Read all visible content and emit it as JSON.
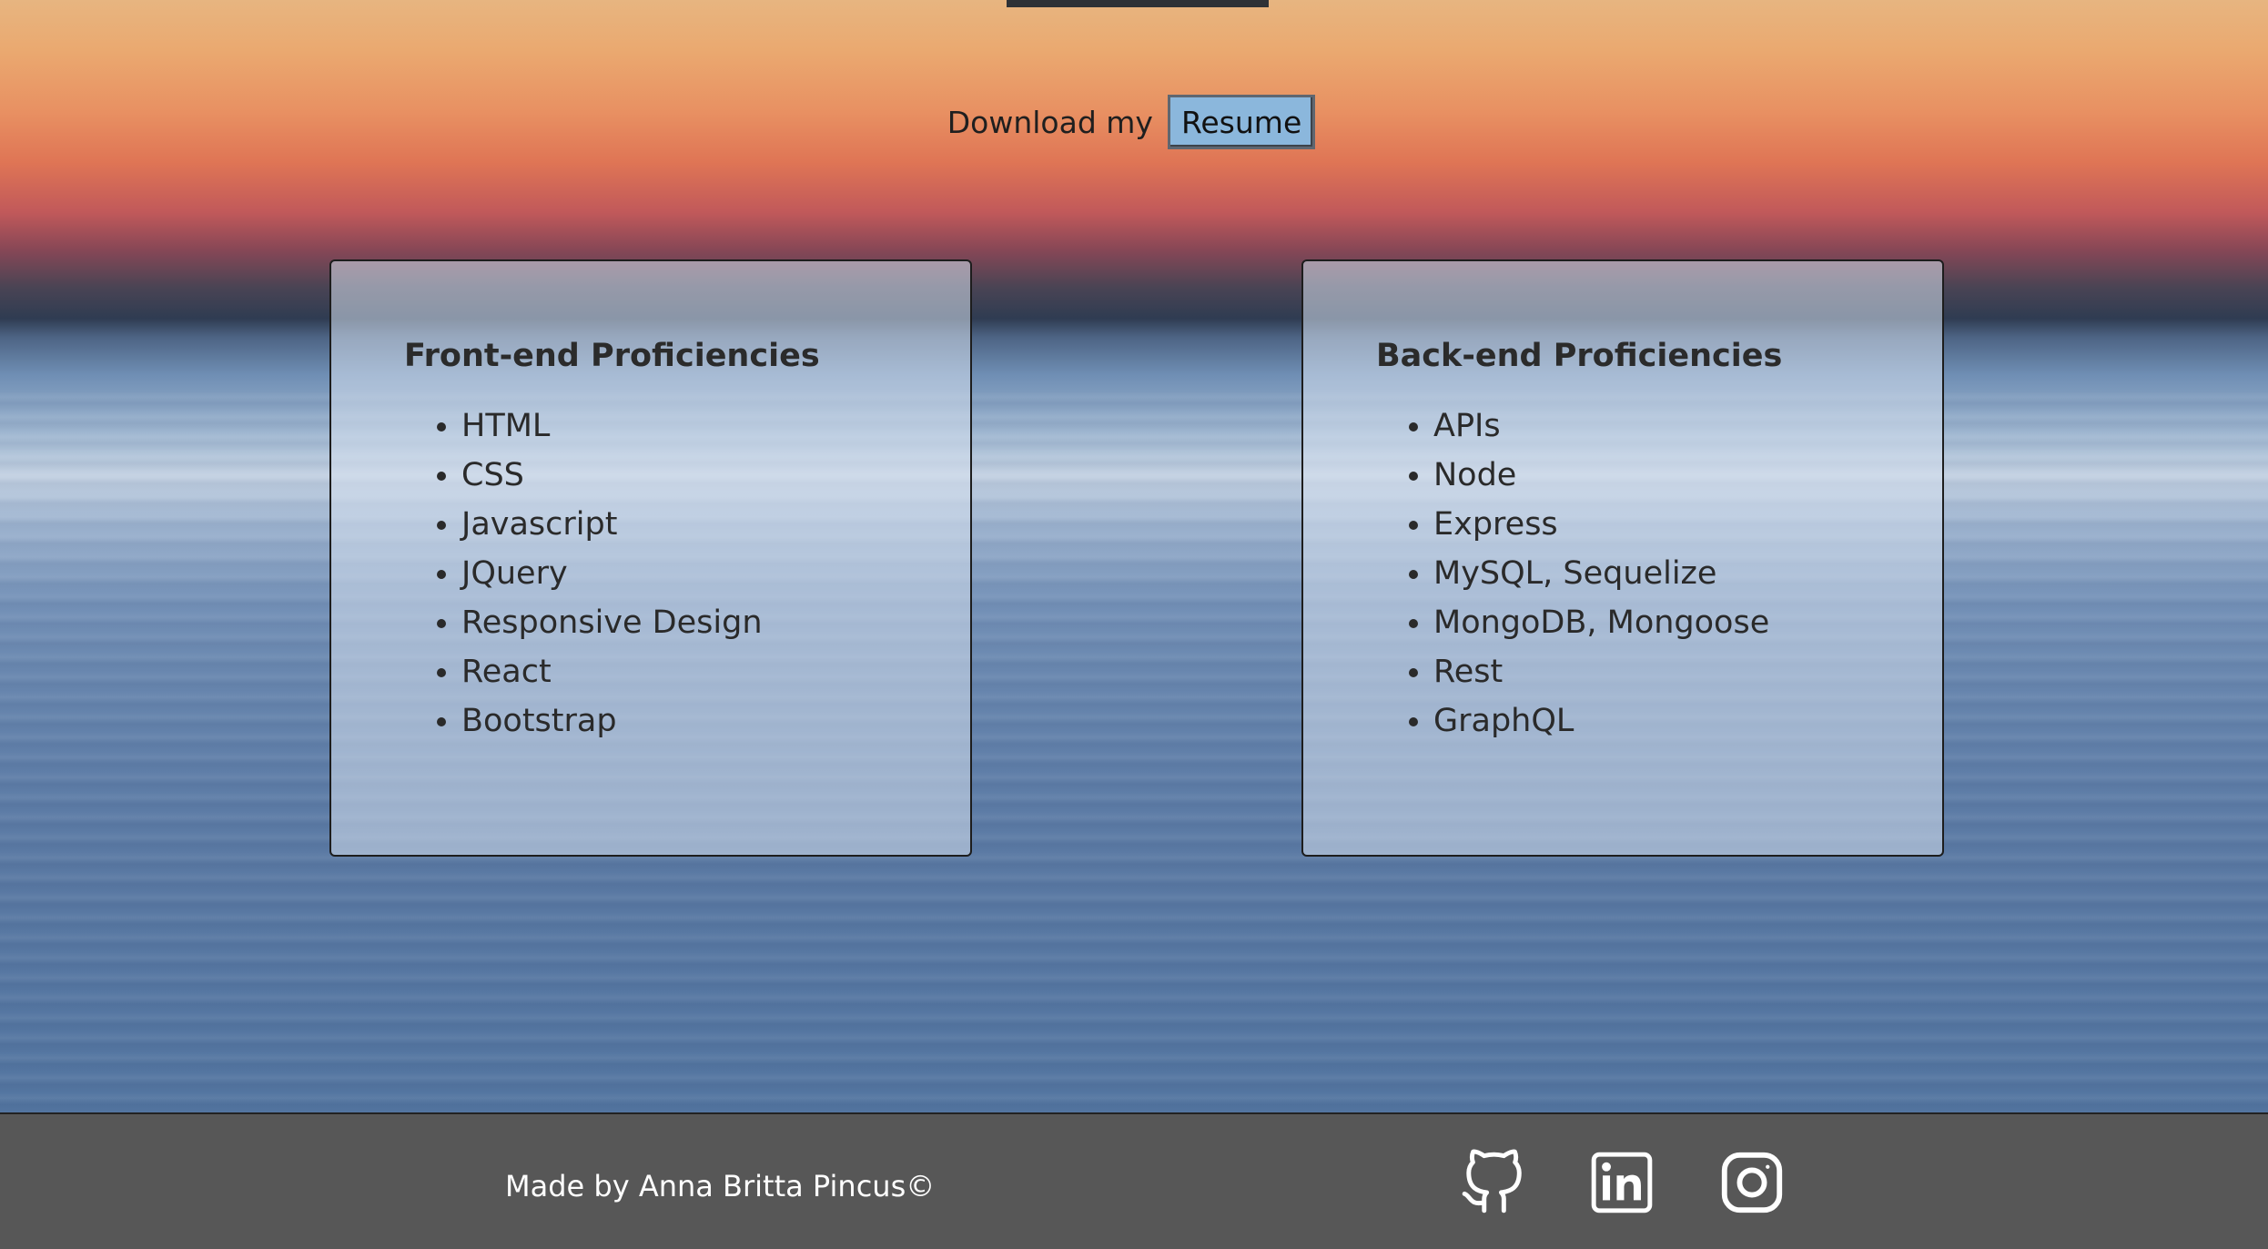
{
  "resume": {
    "lead_text": "Download my",
    "button_label": "Resume"
  },
  "frontend": {
    "title": "Front-end Proficiencies",
    "items": [
      "HTML",
      "CSS",
      "Javascript",
      "JQuery",
      "Responsive Design",
      "React",
      "Bootstrap"
    ]
  },
  "backend": {
    "title": "Back-end Proficiencies",
    "items": [
      "APIs",
      "Node",
      "Express",
      "MySQL, Sequelize",
      "MongoDB, Mongoose",
      "Rest",
      "GraphQL"
    ]
  },
  "footer": {
    "credit": "Made by Anna Britta Pincus©",
    "links": [
      {
        "icon": "github-icon"
      },
      {
        "icon": "linkedin-icon"
      },
      {
        "icon": "instagram-icon"
      }
    ]
  },
  "colors": {
    "resume_button": "#8bb7dc",
    "footer_bg": "#575757"
  }
}
